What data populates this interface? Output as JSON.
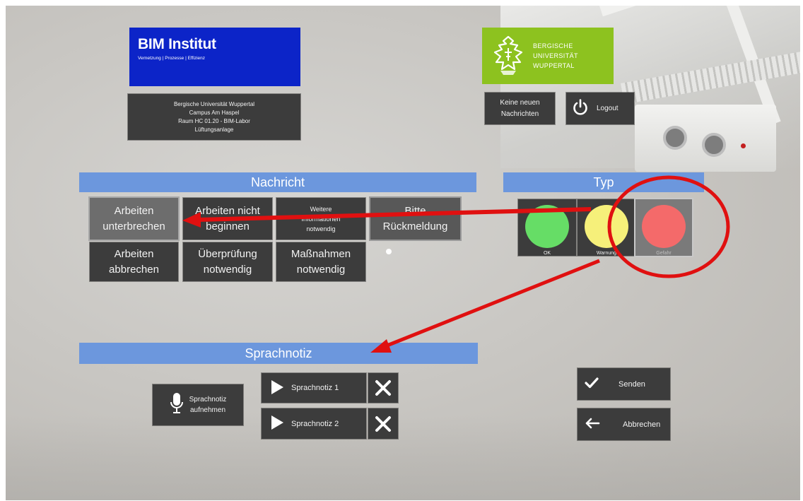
{
  "header": {
    "bim": {
      "title": "BIM Institut",
      "subtitle": "Vernetzung | Prozesse | Effizienz"
    },
    "address_lines": [
      "Bergische Universität Wuppertal",
      "Campus Am Haspel",
      "Raum HC 01.20 - BIM-Labor",
      "Lüftungsanlage"
    ],
    "university": {
      "lines": [
        "BERGISCHE",
        "UNIVERSITÄT",
        "WUPPERTAL"
      ],
      "color": "#8dc21f"
    },
    "messages_button": [
      "Keine neuen",
      "Nachrichten"
    ],
    "logout_label": "Logout"
  },
  "nachricht": {
    "title": "Nachricht",
    "buttons": [
      [
        "Arbeiten",
        "unterbrechen"
      ],
      [
        "Arbeiten nicht",
        "beginnen"
      ],
      [
        "Weitere",
        "Informationen",
        "notwendig"
      ],
      [
        "Bitte",
        "Rückmeldung"
      ],
      [
        "Arbeiten",
        "abbrechen"
      ],
      [
        "Überprüfung",
        "notwendig"
      ],
      [
        "Maßnahmen",
        "notwendig"
      ]
    ],
    "selected_index": 0
  },
  "typ": {
    "title": "Typ",
    "options": [
      {
        "label": "OK",
        "color": "#66dd66"
      },
      {
        "label": "Warnung",
        "color": "#f6f07a"
      },
      {
        "label": "Gefahr",
        "color": "#f46a6a"
      }
    ],
    "selected_index": 2
  },
  "sprachnotiz": {
    "title": "Sprachnotiz",
    "record_label": [
      "Sprachnotiz",
      "aufnehmen"
    ],
    "notes": [
      "Sprachnotiz 1",
      "Sprachnotiz 2"
    ]
  },
  "actions": {
    "send": "Senden",
    "cancel": "Abbrechen"
  },
  "colors": {
    "bar_blue": "#6c97dd",
    "button_dark": "#3c3c3c",
    "annotation_red": "#e01010",
    "bim_blue": "#0c24c8"
  }
}
